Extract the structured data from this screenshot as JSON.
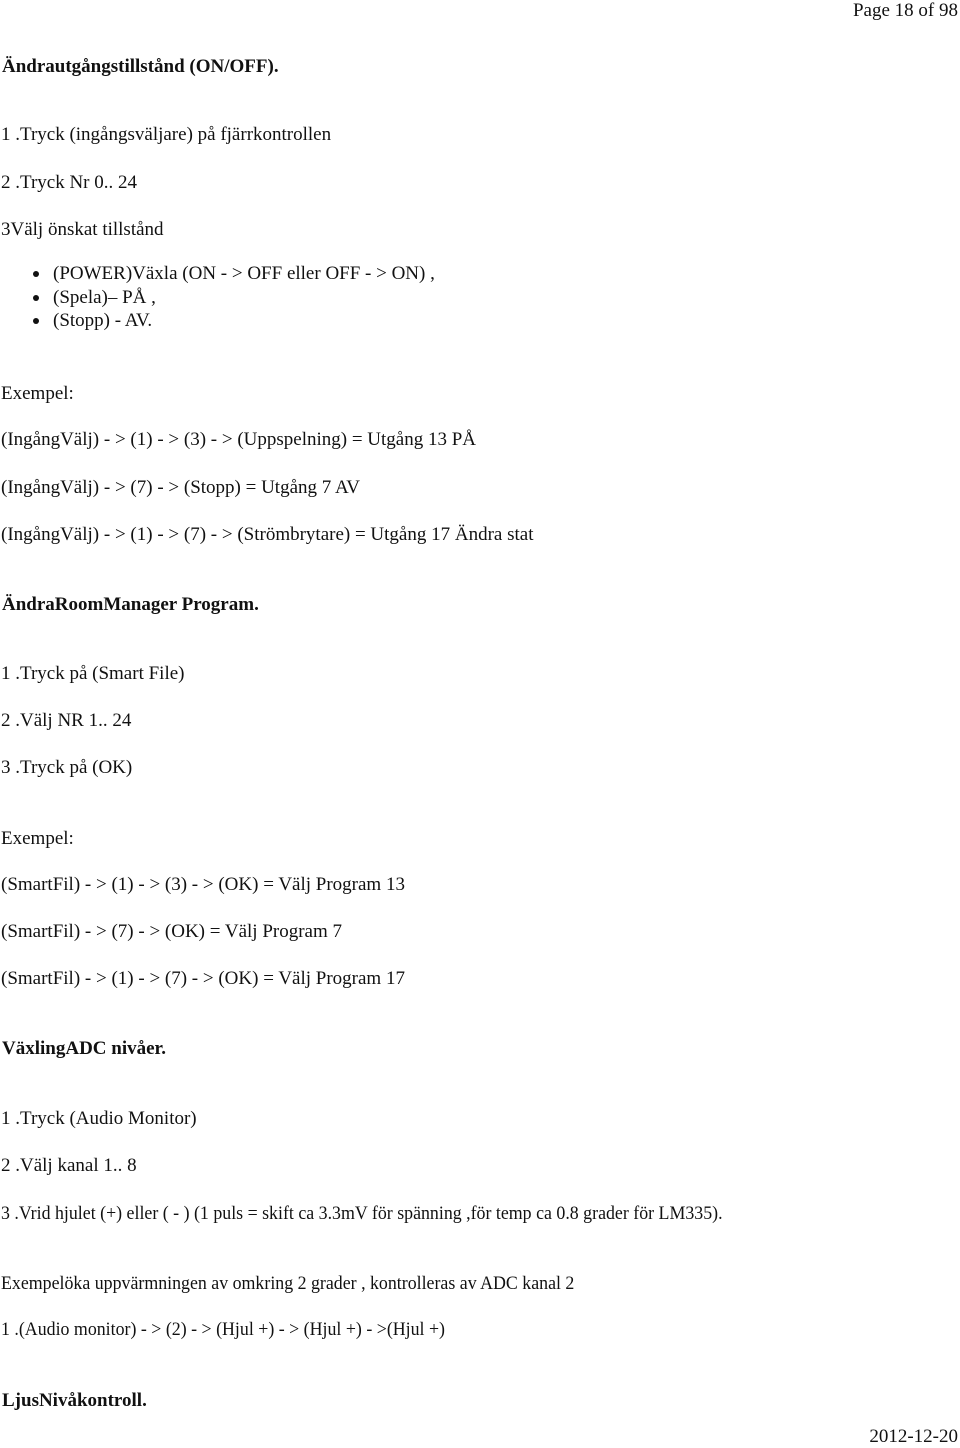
{
  "page_header": {
    "page_indicator": "Page 18 of 98"
  },
  "section_1": {
    "heading": "Ändrautgångstillstånd (ON/OFF).",
    "steps": [
      "1 .Tryck (ingångsväljare) på fjärrkontrollen",
      "2 .Tryck Nr 0.. 24",
      "3Välj önskat tillstånd"
    ],
    "bullets": [
      "(POWER)Växla (ON - > OFF eller OFF - > ON) ,",
      "(Spela)– PÅ ,",
      "(Stopp) - AV."
    ],
    "example_label": "Exempel:",
    "examples": [
      "(IngångVälj) - > (1) - > (3) - > (Uppspelning) = Utgång 13 PÅ",
      "(IngångVälj) - > (7) - > (Stopp) = Utgång 7 AV",
      "(IngångVälj) - > (1) - > (7) - > (Strömbrytare) = Utgång 17 Ändra stat"
    ]
  },
  "section_2": {
    "heading": "ÄndraRoomManager Program.",
    "steps": [
      "1 .Tryck på (Smart File)",
      "2 .Välj NR 1.. 24",
      "3 .Tryck på (OK)"
    ],
    "example_label": "Exempel:",
    "examples": [
      "(SmartFil) - > (1) - > (3) - > (OK) = Välj Program 13",
      "(SmartFil) - > (7) - > (OK) = Välj Program 7",
      "(SmartFil) - > (1) - > (7) - > (OK) = Välj Program 17"
    ]
  },
  "section_3": {
    "heading": "VäxlingADC nivåer.",
    "steps": [
      "1 .Tryck (Audio Monitor)",
      "2 .Välj kanal 1.. 8",
      "3 .Vrid hjulet (+) eller ( - ) (1 puls = skift ca 3.3mV för spänning ,för temp ca 0.8 grader för LM335)."
    ],
    "example_text": "Exempelöka uppvärmningen av omkring 2 grader , kontrolleras av ADC kanal 2",
    "example_step": "1 .(Audio monitor) - > (2) - > (Hjul +) - > (Hjul +) - >(Hjul +)"
  },
  "section_4": {
    "heading": "LjusNivåkontroll."
  },
  "page_footer": {
    "date": "2012-12-20"
  }
}
